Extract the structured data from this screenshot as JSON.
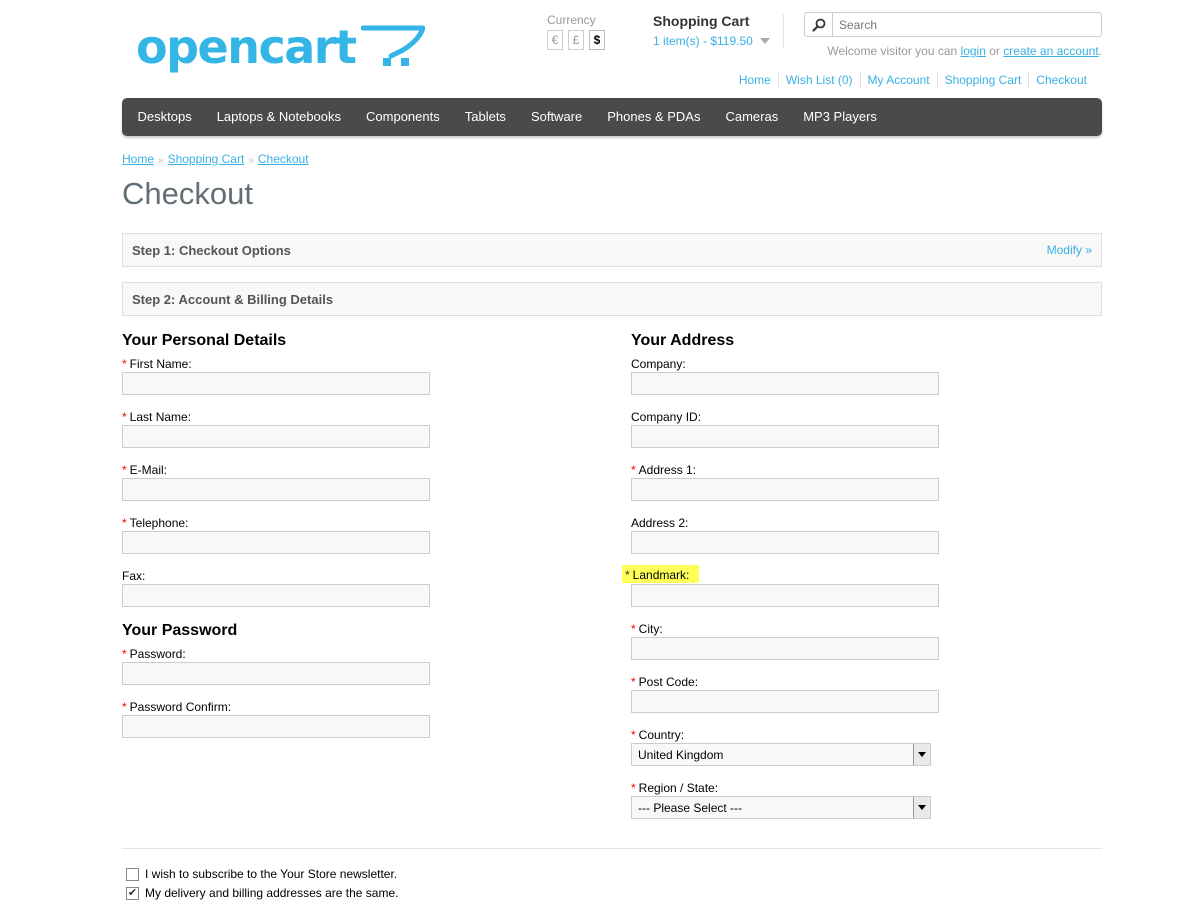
{
  "brand": {
    "logo_text": "opencart",
    "accent": "#33b5e5"
  },
  "currency": {
    "label": "Currency",
    "options": [
      {
        "symbol": "€"
      },
      {
        "symbol": "£"
      },
      {
        "symbol": "$",
        "active": true
      }
    ]
  },
  "cart": {
    "title": "Shopping Cart",
    "total": "1 item(s) - $119.50"
  },
  "search": {
    "placeholder": "Search"
  },
  "welcome": {
    "prefix": "Welcome visitor you can",
    "login": "login",
    "or": "or",
    "create": "create an account",
    "suffix": "."
  },
  "top_links": [
    "Home",
    "Wish List (0)",
    "My Account",
    "Shopping Cart",
    "Checkout"
  ],
  "menu": [
    "Desktops",
    "Laptops & Notebooks",
    "Components",
    "Tablets",
    "Software",
    "Phones & PDAs",
    "Cameras",
    "MP3 Players"
  ],
  "breadcrumb": [
    "Home",
    "Shopping Cart",
    "Checkout"
  ],
  "breadcrumb_sep": "»",
  "page_title": "Checkout",
  "steps": {
    "step1": {
      "title": "Step 1: Checkout Options",
      "modify": "Modify »"
    },
    "step2": {
      "title": "Step 2: Account & Billing Details"
    }
  },
  "personal": {
    "title": "Your Personal Details",
    "first_name": "First Name:",
    "last_name": "Last Name:",
    "email": "E-Mail:",
    "telephone": "Telephone:",
    "fax": "Fax:"
  },
  "password": {
    "title": "Your Password",
    "password": "Password:",
    "confirm": "Password Confirm:"
  },
  "address": {
    "title": "Your Address",
    "company": "Company:",
    "company_id": "Company ID:",
    "address1": "Address 1:",
    "address2": "Address 2:",
    "landmark": "Landmark:",
    "city": "City:",
    "postcode": "Post Code:",
    "country": "Country:",
    "country_value": "United Kingdom",
    "region": "Region / State:",
    "region_value": " --- Please Select --- "
  },
  "required_mark": "*",
  "newsletter": {
    "label": "I wish to subscribe to the Your Store newsletter.",
    "checked": false
  },
  "same_address": {
    "label": "My delivery and billing addresses are the same.",
    "checked": true,
    "check_glyph": "✔"
  },
  "colors": {
    "highlight": "#ffff5a",
    "menu_bg": "#4a4a4a",
    "link": "#38b0e3",
    "required": "#ff0000"
  }
}
